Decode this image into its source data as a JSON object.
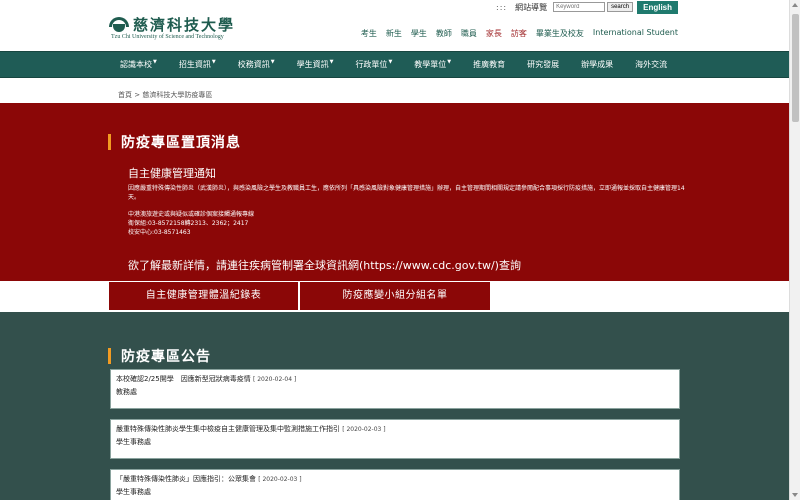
{
  "header": {
    "logo_cn": "慈濟科技大學",
    "logo_en": "Tzu Chi University of Science and Technology",
    "util_dots": ":::",
    "sitemap": "網站導覽",
    "search_placeholder": "Keyword",
    "search_button": "search",
    "english": "English",
    "audience": [
      "考生",
      "新生",
      "學生",
      "教師",
      "職員",
      "家長",
      "訪客",
      "畢業生及校友",
      "International Student"
    ]
  },
  "nav": {
    "items": [
      "認識本校",
      "招生資訊",
      "校務資訊",
      "學生資訊",
      "行政單位",
      "教學單位",
      "推廣教育",
      "研究發展",
      "辦學成果",
      "海外交流"
    ],
    "has_dropdown": [
      true,
      true,
      true,
      true,
      true,
      true,
      false,
      false,
      false,
      false
    ]
  },
  "breadcrumb": {
    "home": "首頁",
    "sep": ">",
    "current": "慈濟科技大學防疫專區"
  },
  "topnews": {
    "title": "防疫專區置頂消息",
    "subtitle": "自主健康管理通知",
    "body": "因應嚴重特殊傳染性肺炎（武漢肺炎），與感染風險之學生及教職員工生，應依所列「具感染風險對象健康管理措施」辦理，自主管理期間相關規定請參閱配合事項採行防疫措施，立即通報並採取自主健康管理14天。",
    "contact1": "中港澳旅遊史或與疑似或確診個案接觸通報專線",
    "contact2": "衛保組:03-8572158轉2313、2362；2417",
    "contact3": "校安中心:03-8571463",
    "cdc": "欲了解最新詳情，請連往疾病管制署全球資訊網(https://www.cdc.gov.tw/)查詢"
  },
  "buttons": {
    "health_log": "自主健康管理體溫紀錄表",
    "team_list": "防疫應變小組分組名單"
  },
  "announce": {
    "title": "防疫專區公告",
    "items": [
      {
        "title": "本校確認2/25開學　因應新型冠狀病毒疫情",
        "date": "[ 2020-02-04 ]",
        "unit": "教務處"
      },
      {
        "title": "嚴重特殊傳染性肺炎學生集中檢疫自主健康管理及集中監測措施工作指引",
        "date": "[ 2020-02-03 ]",
        "unit": "學生事務處"
      },
      {
        "title": "「嚴重特殊傳染性肺炎」因應指引：公眾集會",
        "date": "[ 2020-02-03 ]",
        "unit": "學生事務處"
      }
    ]
  },
  "colors": {
    "primary_green": "#1f5c56",
    "dark_red": "#8b0707",
    "accent_orange": "#f29b22",
    "announce_bg": "#33504c"
  }
}
